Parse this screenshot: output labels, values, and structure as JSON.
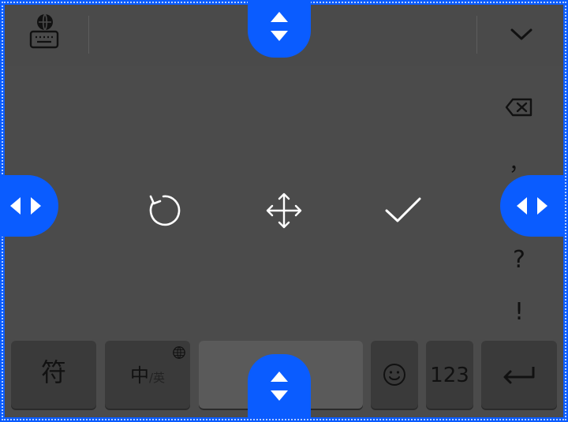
{
  "keyboard": {
    "side_keys": {
      "comma": "，",
      "question": "?",
      "exclaim": "!"
    },
    "bottom_row": {
      "symbols": "符",
      "zh": "中",
      "en": "/英",
      "numbers": "123"
    }
  },
  "icons": {
    "keyboard_language": "keyboard-globe-icon",
    "collapse": "chevron-down-icon",
    "backspace": "backspace-icon",
    "reset": "reset-rotate-icon",
    "move": "move-arrows-icon",
    "confirm": "check-icon",
    "emoji": "emoji-icon",
    "enter": "enter-icon",
    "globe": "globe-icon"
  },
  "colors": {
    "handle": "#0a5cff",
    "panel": "#4b4b4b",
    "key": "#3a3a3a",
    "space": "#5a5a5a"
  }
}
